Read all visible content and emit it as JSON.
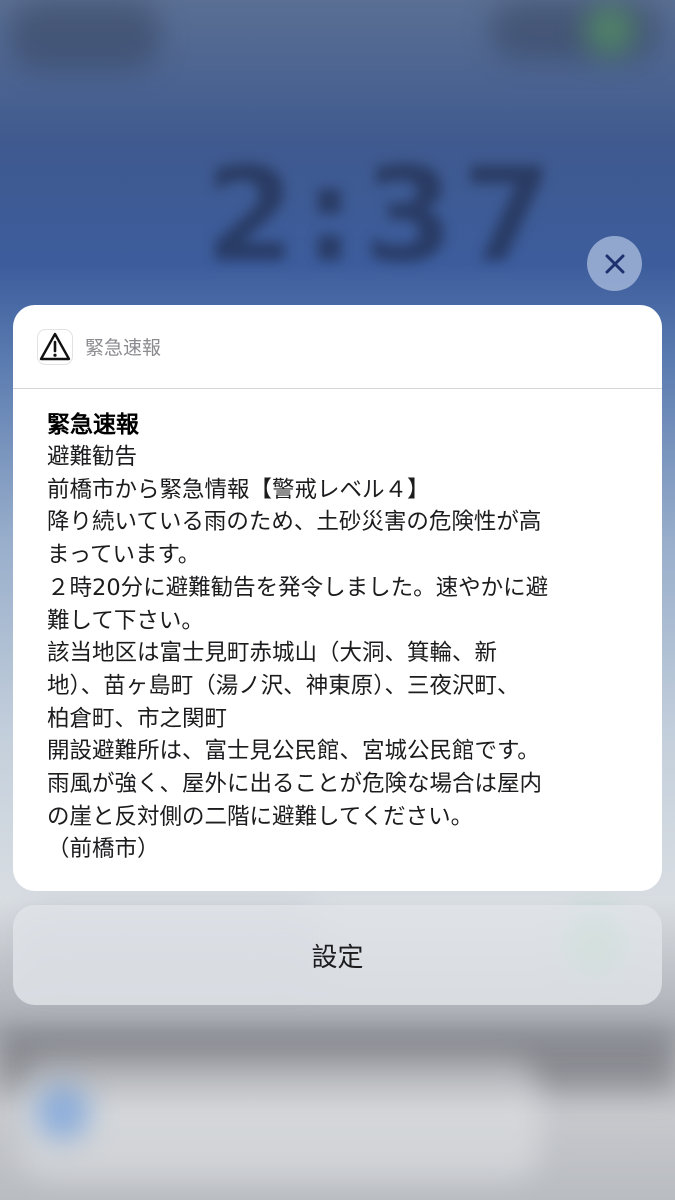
{
  "background": {
    "blurred_clock": "2:37"
  },
  "notification": {
    "app_name": "緊急速報",
    "title": "緊急速報",
    "body_lines": [
      "避難勧告",
      "前橋市から緊急情報【警戒レベル４】",
      "降り続いている雨のため、土砂災害の危険性が高",
      "まっています。",
      "２時20分に避難勧告を発令しました。速やかに避",
      "難して下さい。",
      "該当地区は富士見町赤城山（大洞、箕輪、新",
      "地）、苗ヶ島町（湯ノ沢、神東原）、三夜沢町、",
      "柏倉町、市之関町",
      "開設避難所は、富士見公民館、宮城公民館です。",
      "雨風が強く、屋外に出ることが危険な場合は屋内",
      "の崖と反対側の二階に避難してください。",
      "（前橋市）"
    ]
  },
  "actions": {
    "settings_label": "設定"
  },
  "icons": {
    "close": "close-icon",
    "app": "warning-triangle-icon"
  }
}
